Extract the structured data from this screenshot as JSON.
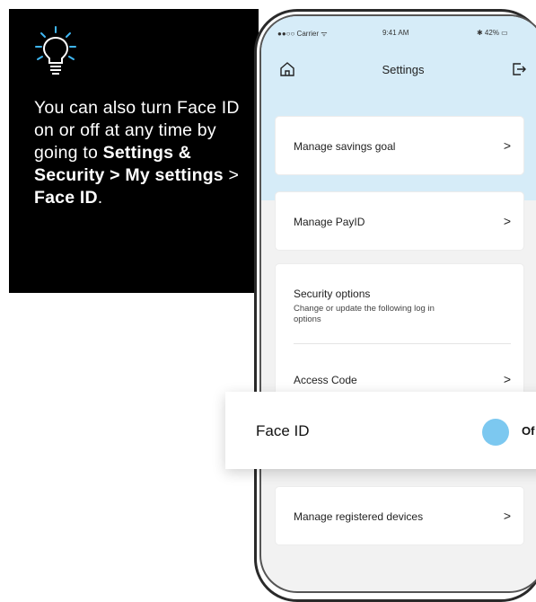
{
  "tip": {
    "icon": "lightbulb-icon",
    "text_1": "You can also turn Face ID on or off at any time by going to ",
    "settings_path": "Settings & Security > My settings",
    "text_2": " > ",
    "face_id_label": "Face ID",
    "text_3": "."
  },
  "status_bar": {
    "carrier": "●●○○ Carrier ᯤ",
    "time": "9:41 AM",
    "battery": "✱ 42% ▭"
  },
  "nav": {
    "title": "Settings",
    "home_icon": "home-icon",
    "logout_icon": "logout-icon"
  },
  "items": {
    "savings": "Manage savings goal",
    "payid": "Manage PayID",
    "security_title": "Security options",
    "security_sub": "Change or update the following log in options",
    "access_code": "Access Code",
    "devices": "Manage registered devices",
    "chevron": ">"
  },
  "faceid": {
    "label": "Face ID",
    "toggle_text": "Of"
  },
  "colors": {
    "header_bg": "#d6ecf8",
    "toggle": "#7cc8f0"
  }
}
